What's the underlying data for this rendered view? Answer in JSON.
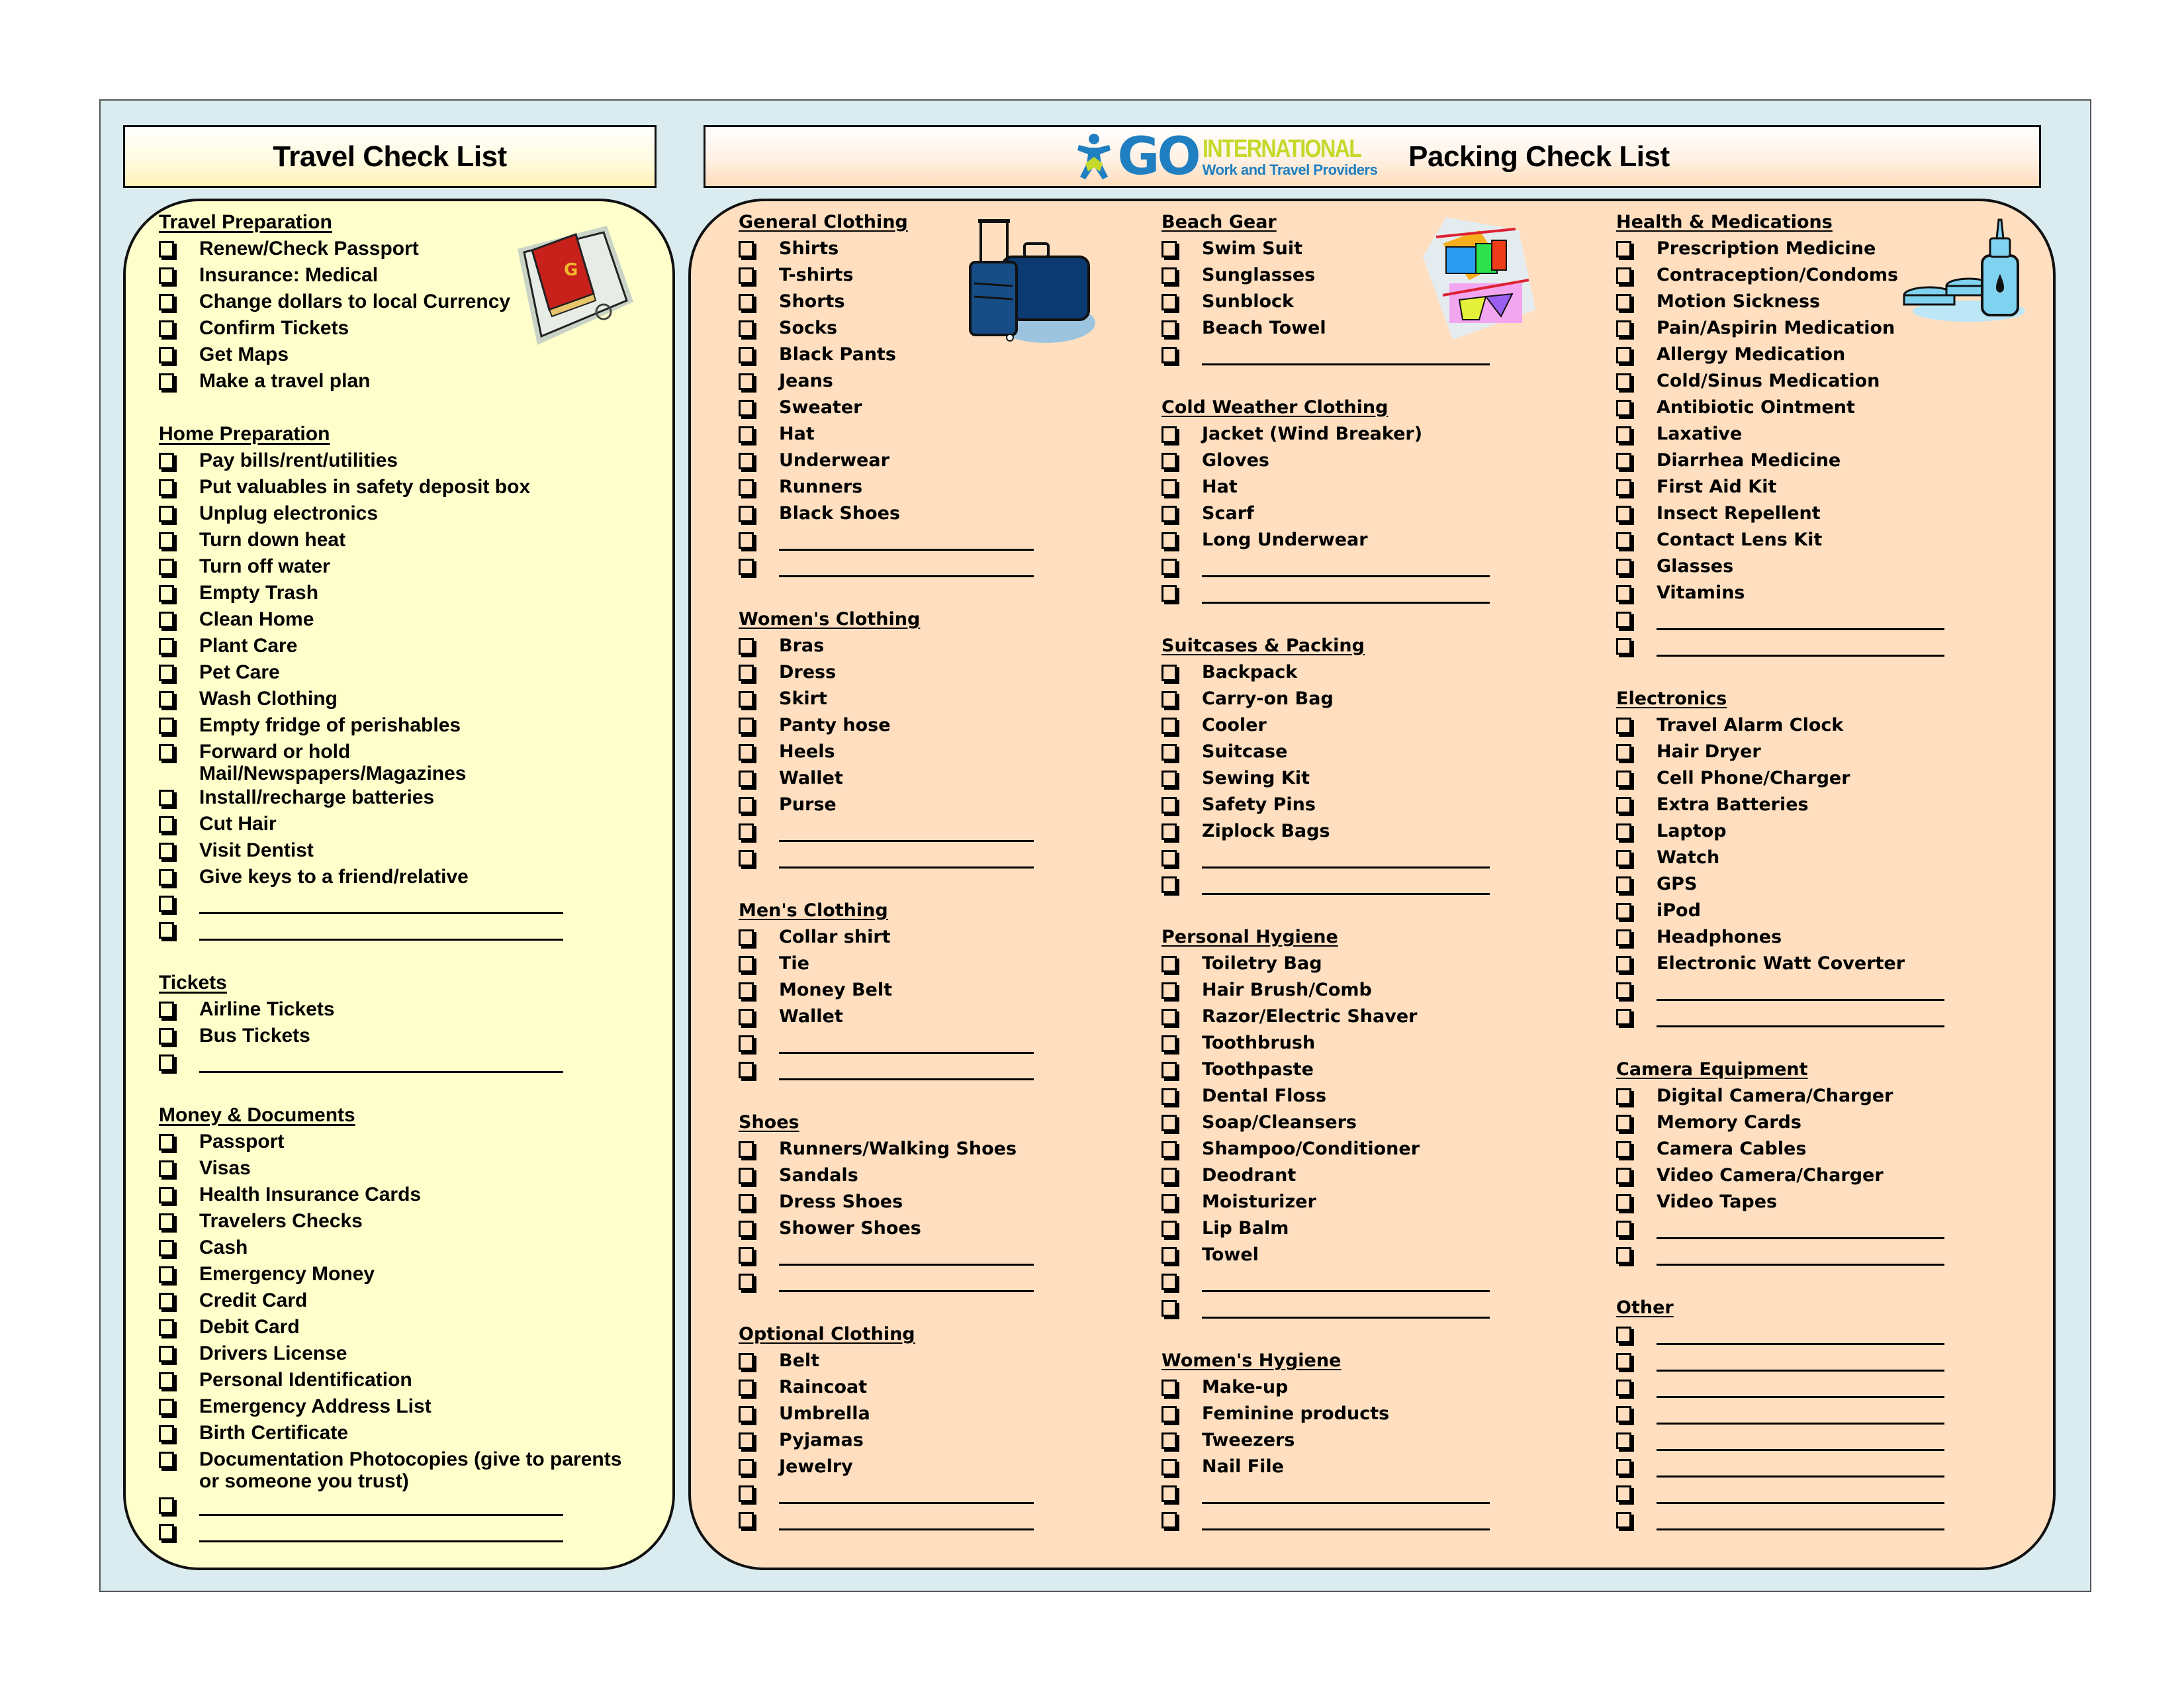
{
  "headers": {
    "travel_title": "Travel Check List",
    "packing_title": "Packing Check List",
    "logo": {
      "brand": "GO",
      "line1": "INTERNATIONAL",
      "line2": "Work and Travel Providers",
      "icon": "person-logo-icon"
    }
  },
  "colors": {
    "frame_bg": "#dbecf0",
    "travel_panel_bg": "#ffffcc",
    "packing_panel_bg": "#ffdfc0",
    "logo_blue": "#1f7fc0",
    "logo_green": "#c4d92a"
  },
  "blank_line": "______________________________",
  "travel_sections": [
    {
      "title": "Travel Preparation",
      "items": [
        "Renew/Check Passport",
        "Insurance: Medical",
        "Change dollars to local Currency",
        "Confirm Tickets",
        "Get Maps",
        "Make a travel plan"
      ],
      "blanks": 0
    },
    {
      "title": "Home Preparation",
      "items": [
        "Pay bills/rent/utilities",
        "Put valuables in safety deposit box",
        "Unplug electronics",
        "Turn down heat",
        "Turn off water",
        "Empty Trash",
        "Clean Home",
        "Plant Care",
        "Pet Care",
        "Wash Clothing",
        "Empty fridge of perishables",
        "Forward or hold Mail/Newspapers/Magazines",
        "Install/recharge batteries",
        "Cut Hair",
        "Visit Dentist",
        "Give keys to a friend/relative"
      ],
      "blanks": 2
    },
    {
      "title": "Tickets",
      "items": [
        "Airline Tickets",
        "Bus Tickets"
      ],
      "blanks": 1
    },
    {
      "title": "Money & Documents",
      "items": [
        "Passport",
        "Visas",
        "Health Insurance Cards",
        "Travelers Checks",
        "Cash",
        "Emergency Money",
        "Credit Card",
        "Debit Card",
        "Drivers License",
        "Personal Identification",
        "Emergency Address List",
        "Birth Certificate",
        "Documentation Photocopies (give to parents or someone you trust)"
      ],
      "blanks": 2
    }
  ],
  "packing_columns": [
    [
      {
        "title": "General Clothing",
        "items": [
          "Shirts",
          "T-shirts",
          "Shorts",
          "Socks",
          "Black Pants",
          "Jeans",
          "Sweater",
          "Hat",
          "Underwear",
          "Runners",
          "Black Shoes"
        ],
        "blanks": 2
      },
      {
        "title": "Women's Clothing",
        "items": [
          "Bras",
          "Dress",
          "Skirt",
          "Panty hose",
          "Heels",
          "Wallet",
          "Purse"
        ],
        "blanks": 2
      },
      {
        "title": "Men's Clothing",
        "items": [
          "Collar shirt",
          "Tie",
          "Money Belt",
          "Wallet"
        ],
        "blanks": 2
      },
      {
        "title": "Shoes",
        "items": [
          "Runners/Walking Shoes",
          "Sandals",
          "Dress Shoes",
          "Shower Shoes"
        ],
        "blanks": 2
      },
      {
        "title": "Optional Clothing",
        "items": [
          "Belt",
          "Raincoat",
          "Umbrella",
          "Pyjamas",
          "Jewelry"
        ],
        "blanks": 2
      }
    ],
    [
      {
        "title": "Beach Gear",
        "items": [
          "Swim Suit",
          "Sunglasses",
          "Sunblock",
          "Beach Towel"
        ],
        "blanks": 1
      },
      {
        "title": "Cold Weather Clothing",
        "items": [
          "Jacket (Wind Breaker)",
          "Gloves",
          "Hat",
          "Scarf",
          "Long Underwear"
        ],
        "blanks": 2
      },
      {
        "title": "Suitcases & Packing",
        "items": [
          "Backpack",
          "Carry-on Bag",
          "Cooler",
          "Suitcase",
          "Sewing Kit",
          "Safety Pins",
          "Ziplock Bags"
        ],
        "blanks": 2
      },
      {
        "title": "Personal Hygiene",
        "items": [
          "Toiletry Bag",
          "Hair Brush/Comb",
          "Razor/Electric Shaver",
          "Toothbrush",
          "Toothpaste",
          "Dental Floss",
          "Soap/Cleansers",
          "Shampoo/Conditioner",
          "Deodrant",
          "Moisturizer",
          "Lip Balm",
          "Towel"
        ],
        "blanks": 2
      },
      {
        "title": "Women's Hygiene",
        "items": [
          "Make-up",
          "Feminine products",
          "Tweezers",
          "Nail File"
        ],
        "blanks": 2
      }
    ],
    [
      {
        "title": "Health & Medications",
        "items": [
          "Prescription Medicine",
          "Contraception/Condoms",
          "Motion Sickness",
          "Pain/Aspirin Medication",
          "Allergy Medication",
          "Cold/Sinus Medication",
          "Antibiotic Ointment",
          "Laxative",
          "Diarrhea Medicine",
          "First Aid Kit",
          "Insect Repellent",
          "Contact Lens Kit",
          "Glasses",
          "Vitamins"
        ],
        "blanks": 2
      },
      {
        "title": "Electronics",
        "items": [
          "Travel Alarm Clock",
          "Hair Dryer",
          "Cell Phone/Charger",
          "Extra Batteries",
          "Laptop",
          "Watch",
          "GPS",
          "iPod",
          "Headphones",
          "Electronic Watt Coverter"
        ],
        "blanks": 2
      },
      {
        "title": "Camera Equipment",
        "items": [
          "Digital Camera/Charger",
          "Memory Cards",
          "Camera Cables",
          "Video Camera/Charger",
          "Video Tapes"
        ],
        "blanks": 2
      },
      {
        "title": "Other",
        "items": [],
        "blanks": 8
      }
    ]
  ],
  "clipart": [
    "passport-icon",
    "luggage-icon",
    "swimwear-icon",
    "medicine-bottle-icon"
  ]
}
